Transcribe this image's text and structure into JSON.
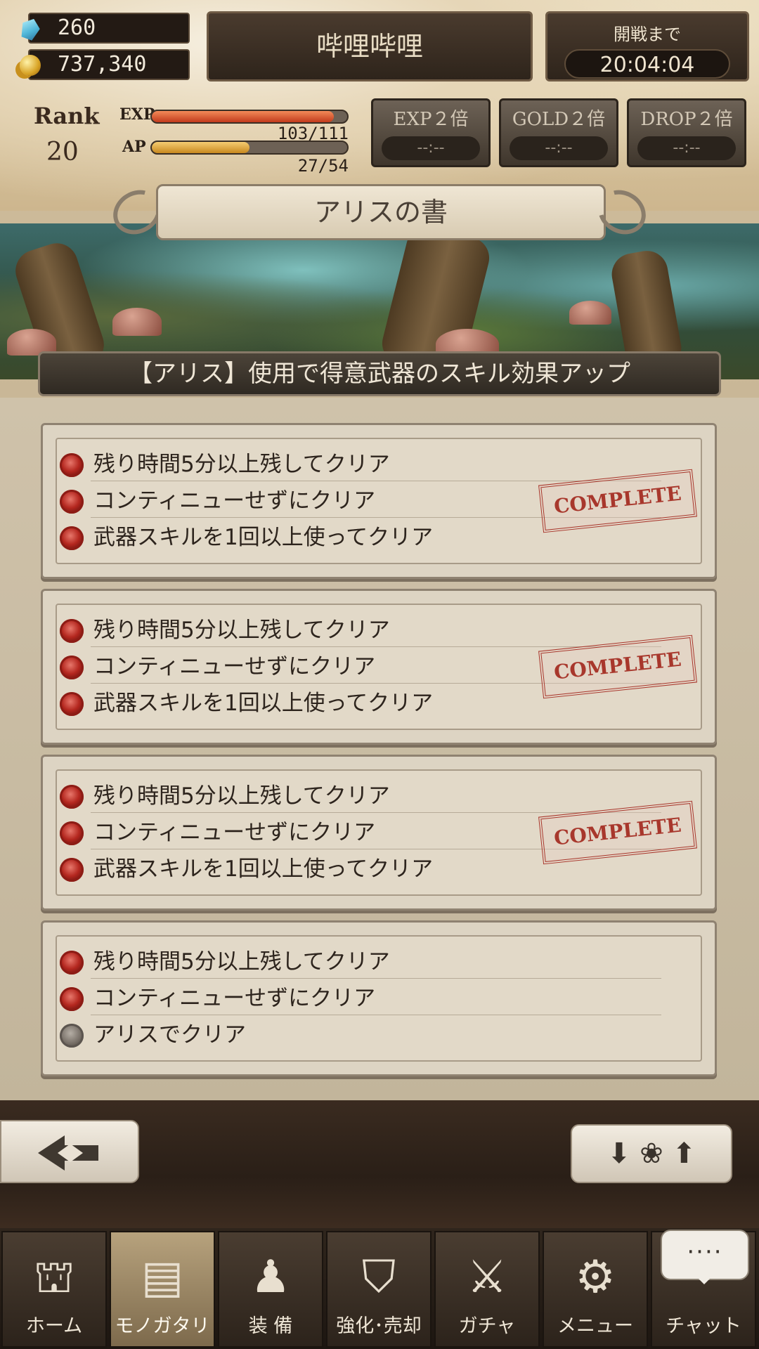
{
  "hud": {
    "gems": "260",
    "gold": "737,340",
    "player_name": "哔哩哔哩",
    "battle_label": "開戦まで",
    "battle_time": "20:04:04",
    "rank_label": "Rank",
    "rank_value": "20",
    "exp_label": "EXP",
    "exp_text": "103/111",
    "exp_fraction": 0.93,
    "ap_label": "AP",
    "ap_text": "27/54",
    "ap_fraction": 0.5,
    "boosts": [
      {
        "label": "EXP２倍",
        "value": "--:--"
      },
      {
        "label": "GOLD２倍",
        "value": "--:--"
      },
      {
        "label": "DROP２倍",
        "value": "--:--"
      }
    ]
  },
  "book": {
    "title": "アリスの書",
    "subtitle": "【アリス】使用で得意武器のスキル効果アップ"
  },
  "missions": [
    {
      "rows": [
        {
          "text": "残り時間5分以上残してクリア",
          "done": true
        },
        {
          "text": "コンティニューせずにクリア",
          "done": true
        },
        {
          "text": "武器スキルを1回以上使ってクリア",
          "done": true
        }
      ],
      "stamp": "COMPLETE"
    },
    {
      "rows": [
        {
          "text": "残り時間5分以上残してクリア",
          "done": true
        },
        {
          "text": "コンティニューせずにクリア",
          "done": true
        },
        {
          "text": "武器スキルを1回以上使ってクリア",
          "done": true
        }
      ],
      "stamp": "COMPLETE"
    },
    {
      "rows": [
        {
          "text": "残り時間5分以上残してクリア",
          "done": true
        },
        {
          "text": "コンティニューせずにクリア",
          "done": true
        },
        {
          "text": "武器スキルを1回以上使ってクリア",
          "done": true
        }
      ],
      "stamp": "COMPLETE"
    },
    {
      "rows": [
        {
          "text": "残り時間5分以上残してクリア",
          "done": true
        },
        {
          "text": "コンティニューせずにクリア",
          "done": true
        },
        {
          "text": "アリスでクリア",
          "done": false
        }
      ],
      "stamp": ""
    }
  ],
  "nav": {
    "items": [
      {
        "label": "ホーム",
        "icon": "castle-icon"
      },
      {
        "label": "モノガタリ",
        "icon": "book-icon"
      },
      {
        "label": "装 備",
        "icon": "puppet-icon"
      },
      {
        "label": "強化･売却",
        "icon": "helmet-icon"
      },
      {
        "label": "ガチャ",
        "icon": "crossed-weapons-icon"
      },
      {
        "label": "メニュー",
        "icon": "gears-icon"
      },
      {
        "label": "チャット",
        "icon": "chat-bubble-icon"
      }
    ],
    "chat_bubble": "····"
  },
  "colors": {
    "rose_done": "#b4271f",
    "rose_pending": "#7a726a",
    "stamp": "#a8372c",
    "exp_fill": "#c23b1c",
    "ap_fill": "#c8891f"
  }
}
